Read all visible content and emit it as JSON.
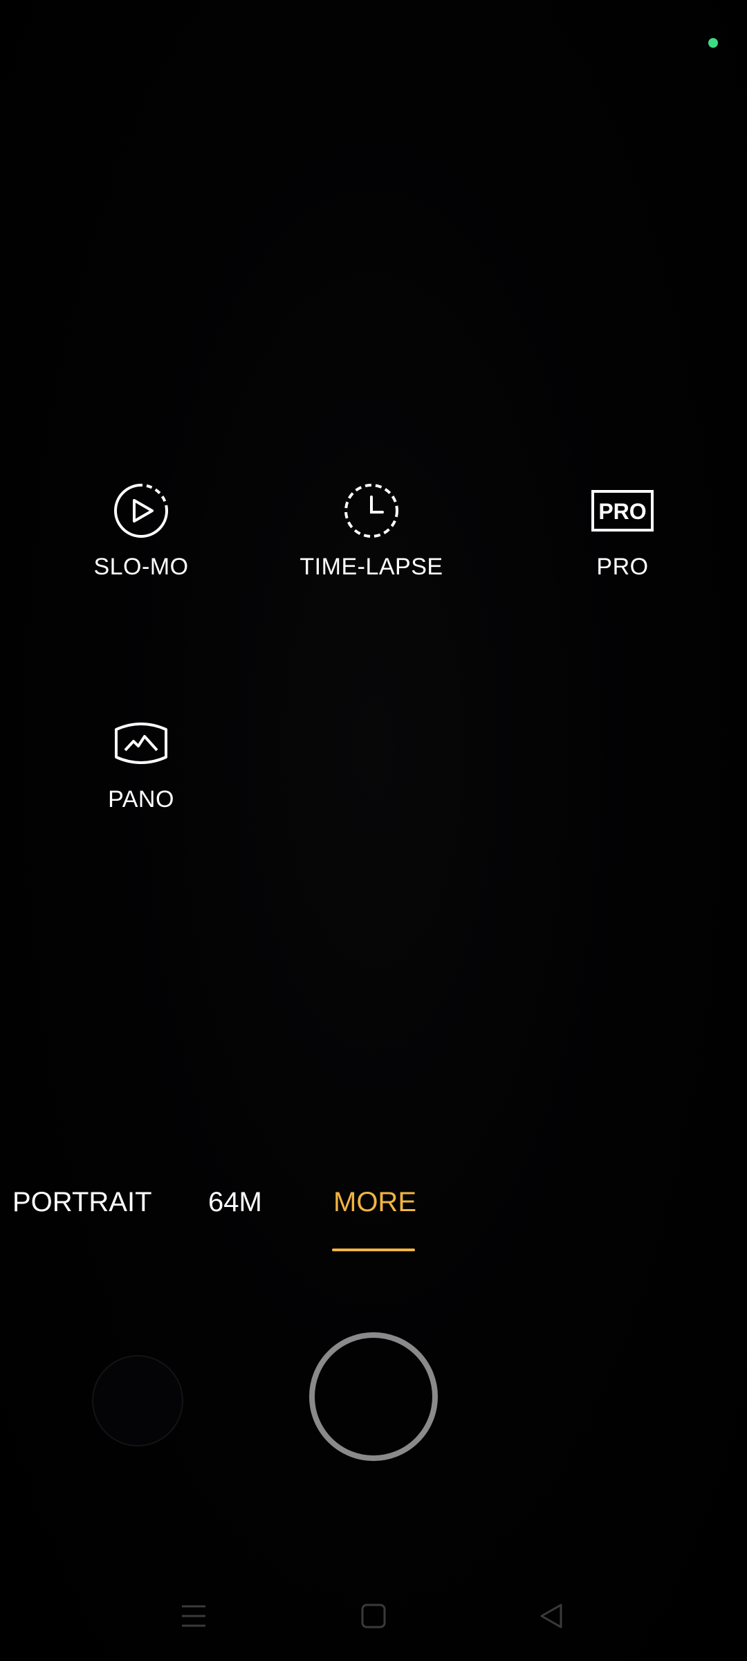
{
  "colors": {
    "accent": "#F2B441",
    "status_dot": "#3DDC84",
    "text": "#FFFFFF",
    "shutter_ring": "#8A8A8A",
    "nav_icon": "#3A3A3A"
  },
  "modes": [
    {
      "label": "SLO-MO",
      "icon": "slow-motion-icon"
    },
    {
      "label": "TIME-LAPSE",
      "icon": "time-lapse-icon"
    },
    {
      "label": "PRO",
      "icon": "pro-mode-icon",
      "icon_text": "PRO"
    },
    {
      "label": "PANO",
      "icon": "panorama-icon"
    }
  ],
  "tabs": [
    {
      "label": "PORTRAIT",
      "selected": false
    },
    {
      "label": "64M",
      "selected": false
    },
    {
      "label": "MORE",
      "selected": true
    }
  ],
  "nav": {
    "icons": [
      "menu-icon",
      "home-square-icon",
      "back-triangle-icon"
    ]
  }
}
